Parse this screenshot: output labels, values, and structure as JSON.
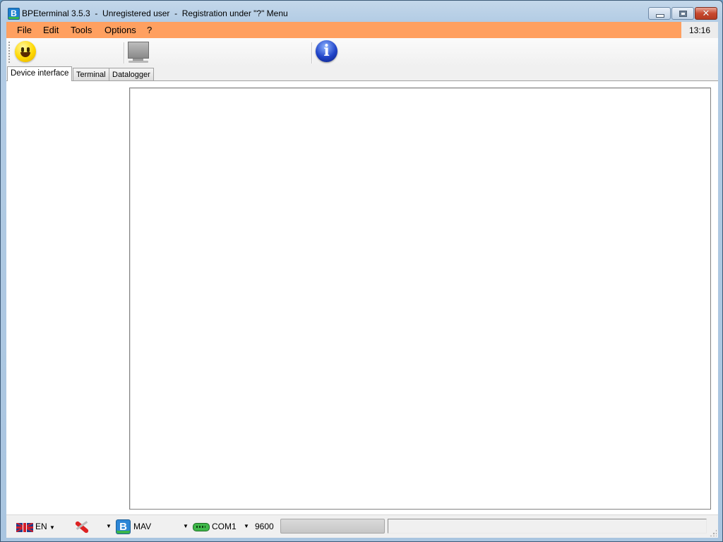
{
  "window": {
    "title": "BPEterminal 3.5.3  -  Unregistered user  -  Registration under \"?\" Menu",
    "app_icon_letter": "B",
    "controls": {
      "minimize": "minimize",
      "maximize": "restore",
      "close": "✕"
    }
  },
  "menu": {
    "items": [
      {
        "label": "File"
      },
      {
        "label": "Edit"
      },
      {
        "label": "Tools"
      },
      {
        "label": "Options"
      },
      {
        "label": "?"
      }
    ],
    "clock": "13:16",
    "accent_color": "#ffa060"
  },
  "toolbar": {
    "buttons": [
      {
        "icon": "smiley-icon",
        "label": "Smiley"
      },
      {
        "icon": "monitor-icon",
        "label": "Monitor"
      },
      {
        "icon": "info-icon",
        "label": "i"
      }
    ]
  },
  "tabs": [
    {
      "label": "Device interface",
      "active": true
    },
    {
      "label": "Terminal",
      "active": false
    },
    {
      "label": "Datalogger",
      "active": false
    }
  ],
  "statusbar": {
    "language": "EN",
    "tool_icon": "swiss-knife-icon",
    "device_letter": "B",
    "device": "MAV",
    "port": "COM1",
    "baud": "9600",
    "progress_percent": 0,
    "status_text": ""
  }
}
